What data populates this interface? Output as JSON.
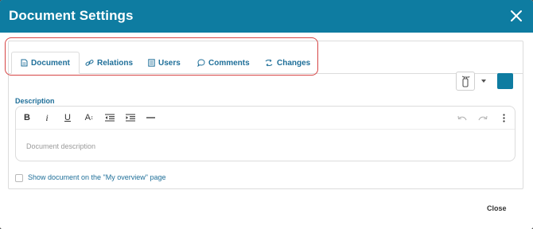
{
  "dialog": {
    "title": "Document Settings"
  },
  "tabs": [
    {
      "label": "Document",
      "active": true
    },
    {
      "label": "Relations"
    },
    {
      "label": "Users"
    },
    {
      "label": "Comments"
    },
    {
      "label": "Changes"
    }
  ],
  "icons": {
    "close": "close-icon",
    "style_picker": "fire-extinguisher-icon",
    "color_swatch": "color-swatch"
  },
  "colors": {
    "brand": "#0e7ca1",
    "label": "#1f6f99",
    "highlight_outline": "#d64545"
  },
  "description": {
    "label": "Description",
    "placeholder": "Document description",
    "toolbar": [
      "Bold",
      "Italic",
      "Underline",
      "Font size",
      "Decrease indent",
      "Increase indent",
      "Horizontal rule",
      "Undo",
      "Redo",
      "More"
    ]
  },
  "overview_checkbox": {
    "label": "Show document on the \"My overview\" page",
    "checked": false
  },
  "footer": {
    "close_label": "Close"
  }
}
